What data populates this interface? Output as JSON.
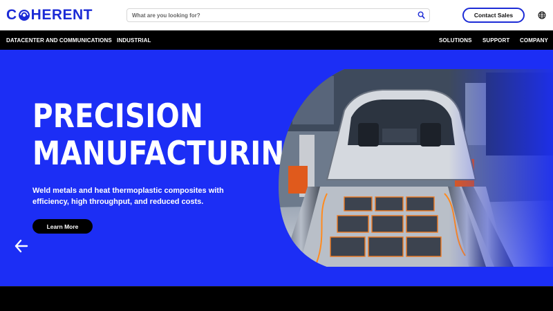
{
  "header": {
    "logo_text": "COHERENT",
    "search_placeholder": "What are you looking for?",
    "contact_label": "Contact Sales",
    "search_icon": "search-icon",
    "globe_icon": "globe-icon"
  },
  "nav": {
    "left": [
      "DATACENTER AND COMMUNICATIONS",
      "INDUSTRIAL"
    ],
    "right": [
      "SOLUTIONS",
      "SUPPORT",
      "COMPANY"
    ]
  },
  "hero": {
    "title_line1": "PRECISION",
    "title_line2": "MANUFACTURING",
    "body": "Weld metals and heat thermoplastic composites with efficiency, high throughput, and reduced costs.",
    "cta_label": "Learn More",
    "prev_icon": "arrow-left-icon",
    "next_icon": "arrow-right-icon"
  },
  "colors": {
    "brand_blue": "#1c2ef5",
    "logo_blue": "#1c2bd6",
    "nav_bg": "#000000",
    "cta_bg": "#000000"
  }
}
